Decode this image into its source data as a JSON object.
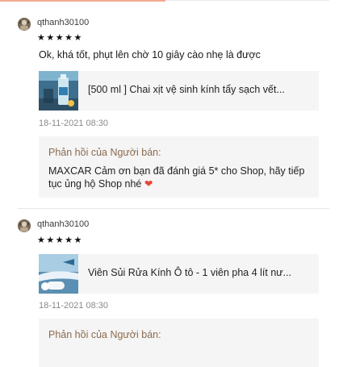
{
  "reviews": [
    {
      "username": "qthanh30100",
      "stars": "★★★★★",
      "rating": 5,
      "comment": "Ok, khá tốt, phụt lên chờ 10 giây cào nhẹ là được",
      "product_name": "[500 ml ] Chai xịt vệ sinh kính tẩy sạch vết...",
      "date": "18-11-2021 08:30",
      "reply_label": "Phản hồi của Người bán:",
      "reply_text": "MAXCAR Cảm ơn bạn đã đánh giá 5* cho Shop, hãy tiếp tục ủng hộ Shop nhé",
      "reply_emoji": "❤"
    },
    {
      "username": "qthanh30100",
      "stars": "★★★★★",
      "rating": 5,
      "product_name": "Viên Sủi Rửa Kính Ô tô - 1 viên pha 4 lít nư...",
      "date": "18-11-2021 08:30",
      "reply_label": "Phản hồi của Người bán:"
    }
  ],
  "colors": {
    "reply_label": "#8b6a4e",
    "panel_bg": "#f5f5f5",
    "heart": "#e8443a",
    "date": "#8a8a8a"
  },
  "icons": {
    "avatar": "user-avatar-icon",
    "star": "star-icon",
    "heart": "heart-icon"
  }
}
